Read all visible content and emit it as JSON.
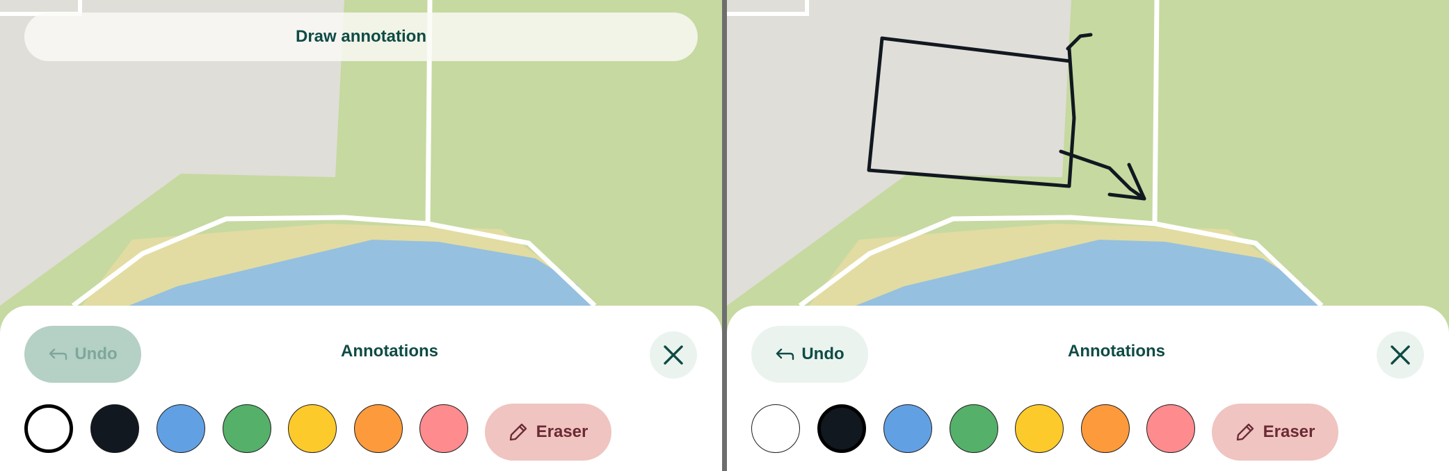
{
  "left": {
    "banner": "Draw annotation",
    "undo_label": "Undo",
    "panel_title": "Annotations",
    "eraser_label": "Eraser",
    "selected_color": "white",
    "undo_enabled": false
  },
  "right": {
    "undo_label": "Undo",
    "panel_title": "Annotations",
    "eraser_label": "Eraser",
    "selected_color": "black",
    "undo_enabled": true
  },
  "palette": [
    {
      "name": "white",
      "hex": "#ffffff"
    },
    {
      "name": "black",
      "hex": "#111820"
    },
    {
      "name": "blue",
      "hex": "#62a0e4"
    },
    {
      "name": "green",
      "hex": "#55b06a"
    },
    {
      "name": "yellow",
      "hex": "#fdca2c"
    },
    {
      "name": "orange",
      "hex": "#fd9a3c"
    },
    {
      "name": "pink",
      "hex": "#fe8b8e"
    }
  ],
  "icons": {
    "undo": "undo-arrow-icon",
    "close": "close-x-icon",
    "eraser": "pencil-icon"
  }
}
